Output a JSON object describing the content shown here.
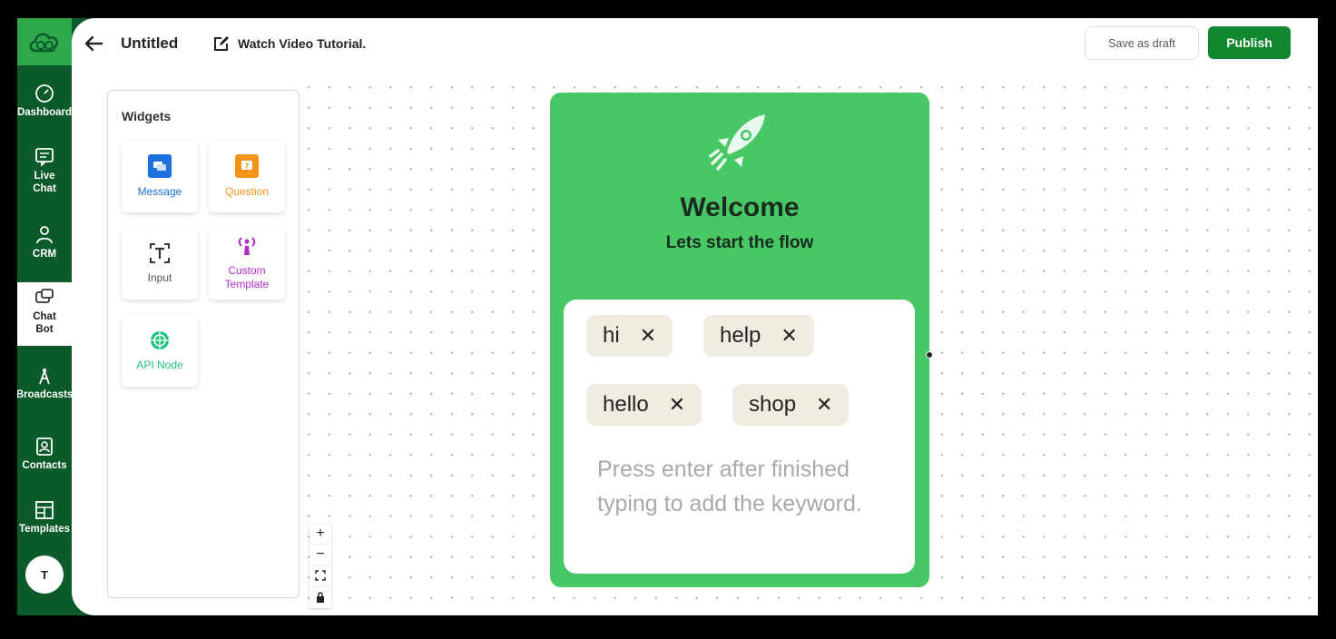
{
  "header": {
    "title": "Untitled",
    "tutorial_label": "Watch Video Tutorial.",
    "save_draft_label": "Save as draft",
    "publish_label": "Publish"
  },
  "sidebar": {
    "items": [
      {
        "label": "Dashboard",
        "icon": "gauge-icon"
      },
      {
        "label": "Live Chat",
        "icon": "chat-icon"
      },
      {
        "label": "CRM",
        "icon": "crm-icon"
      },
      {
        "label": "Chat Bot",
        "icon": "chatbot-icon",
        "active": true
      },
      {
        "label": "Broadcasts",
        "icon": "broadcast-tower-icon"
      },
      {
        "label": "Contacts",
        "icon": "contacts-icon"
      },
      {
        "label": "Templates",
        "icon": "templates-icon"
      }
    ],
    "avatar_initial": "T"
  },
  "widgets": {
    "title": "Widgets",
    "items": [
      {
        "label": "Message",
        "color": "#1e6fe0",
        "icon": "message-icon"
      },
      {
        "label": "Question",
        "color": "#f39419",
        "icon": "question-icon"
      },
      {
        "label": "Input",
        "color": "#555555",
        "icon": "text-input-icon"
      },
      {
        "label": "Custom Template",
        "color": "#b52ad0",
        "icon": "custom-template-icon"
      },
      {
        "label": "API Node",
        "color": "#1fc27a",
        "icon": "api-icon"
      }
    ]
  },
  "zoom_controls": {
    "zoom_in": "+",
    "zoom_out": "−"
  },
  "node": {
    "title": "Welcome",
    "subtitle": "Lets start the flow",
    "keywords": [
      "hi",
      "help",
      "hello",
      "shop"
    ],
    "remove_symbol": "✕",
    "placeholder": "Press enter after finished typing to add the keyword."
  },
  "colors": {
    "brand_green": "#12872f",
    "node_green": "#48c864",
    "sidebar_dark": "#0b5a2a"
  }
}
